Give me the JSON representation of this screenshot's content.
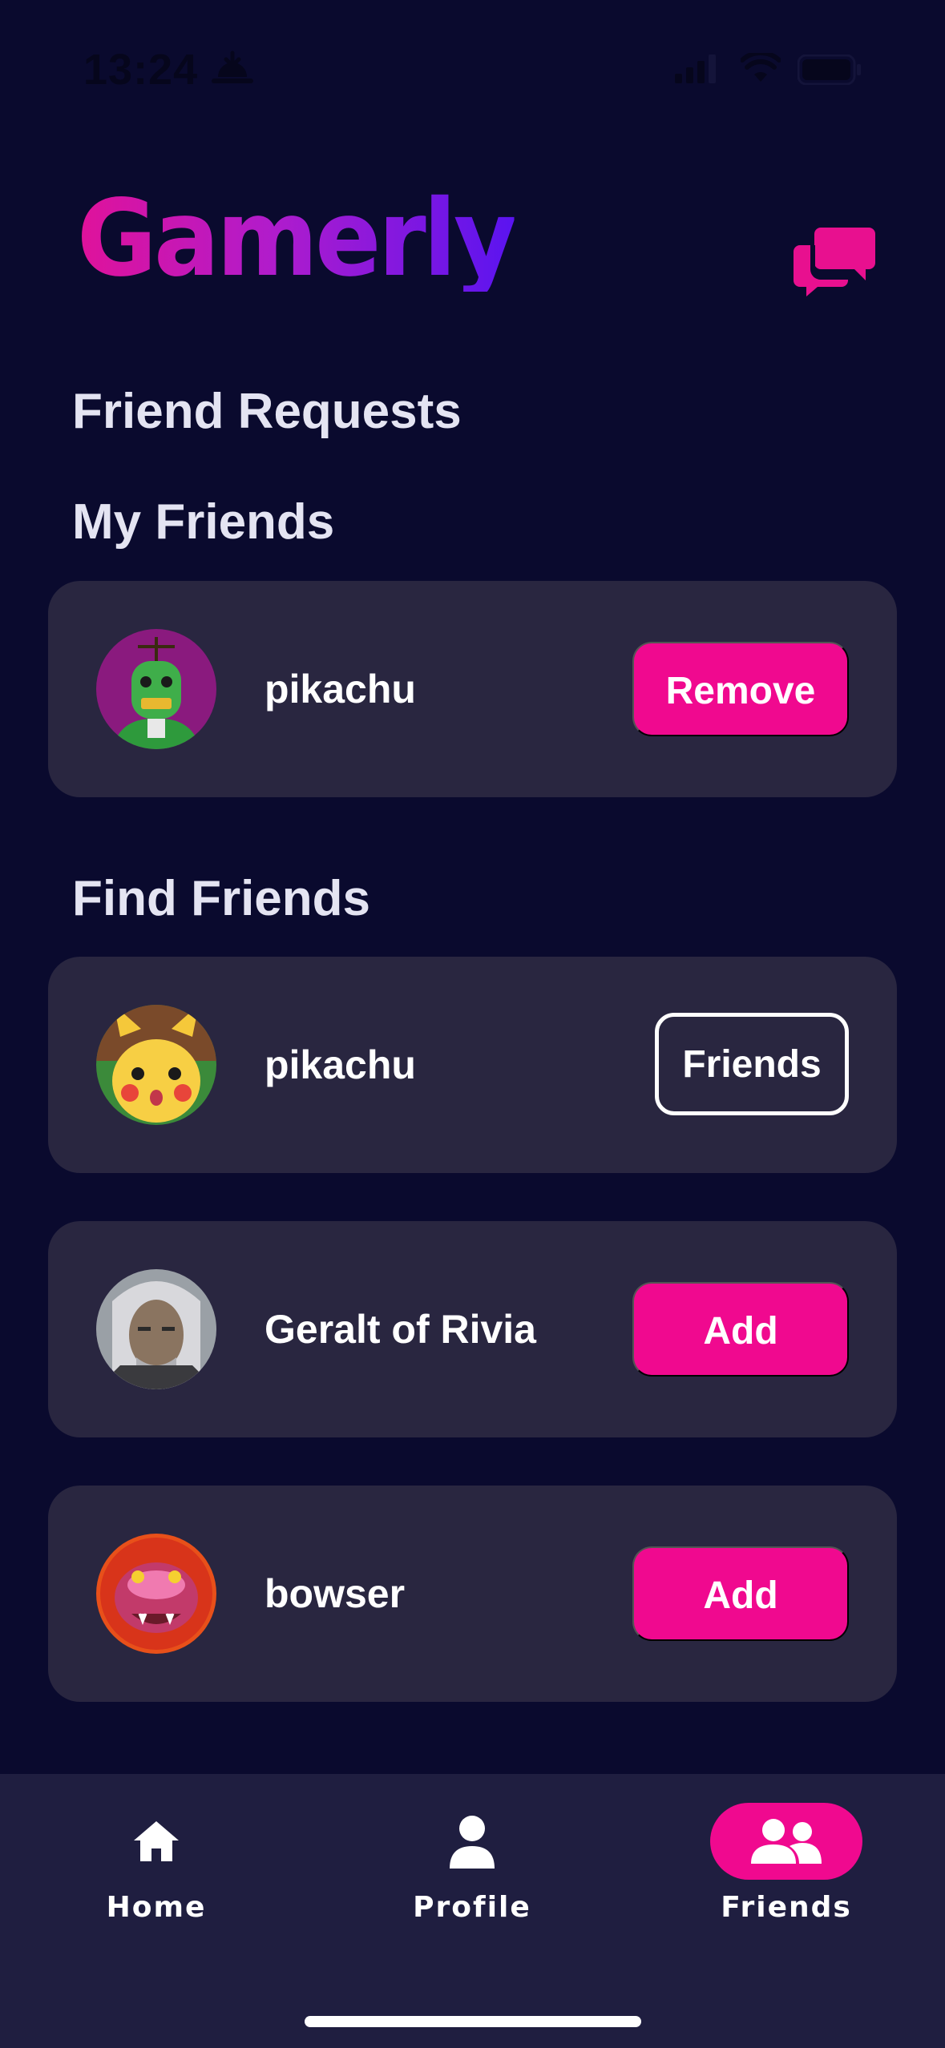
{
  "status_bar": {
    "time": "13:24",
    "alarm_icon": "alarm-sunrise-icon",
    "signal_icon": "cellular-signal-icon",
    "wifi_icon": "wifi-icon",
    "battery_icon": "battery-icon"
  },
  "header": {
    "logo": "Gamerly",
    "chat_icon": "chat-bubbles-icon"
  },
  "sections": {
    "friend_requests": "Friend Requests",
    "my_friends": "My Friends",
    "find_friends": "Find Friends"
  },
  "my_friends": [
    {
      "username": "pikachu",
      "avatar_icon": "robot-avatar",
      "action": "Remove"
    }
  ],
  "find_friends": [
    {
      "username": "pikachu",
      "avatar_icon": "pikachu-avatar",
      "action": "Friends"
    },
    {
      "username": "Geralt of Rivia",
      "avatar_icon": "geralt-avatar",
      "action": "Add"
    },
    {
      "username": "bowser",
      "avatar_icon": "bowser-avatar",
      "action": "Add"
    }
  ],
  "tab_bar": {
    "tabs": [
      {
        "label": "Home",
        "icon": "home-icon"
      },
      {
        "label": "Profile",
        "icon": "person-icon"
      },
      {
        "label": "Friends",
        "icon": "people-icon"
      }
    ],
    "active": "Friends"
  },
  "colors": {
    "background": "#0a0a2e",
    "card": "#292640",
    "accent_pink": "#f0098f",
    "tab_bar": "#1f1e40",
    "logo_gradient_start": "#e0129a",
    "logo_gradient_end": "#5a14f0"
  }
}
